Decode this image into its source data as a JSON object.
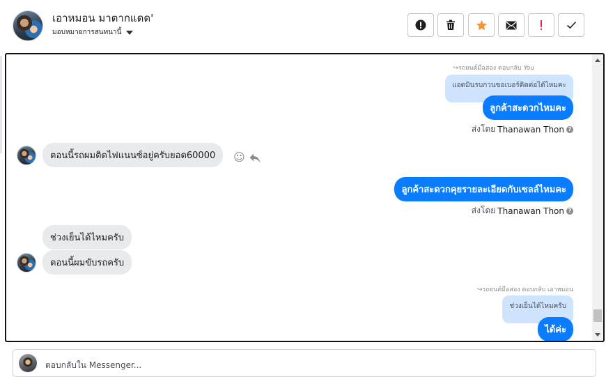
{
  "contact": {
    "name": "เอาหมอน มาตากแดด'",
    "assign_label": "มอบหมายการสนทนานี้"
  },
  "toolbar": {
    "buttons": [
      {
        "name": "spam-button",
        "icon": "alert-circle-icon",
        "glyph": "!",
        "color": "#1c1e21"
      },
      {
        "name": "delete-button",
        "icon": "trash-icon",
        "glyph": "🗑",
        "color": "#1c1e21"
      },
      {
        "name": "star-button",
        "icon": "star-icon",
        "glyph": "★",
        "color": "#f7923a"
      },
      {
        "name": "mark-unread-button",
        "icon": "envelope-icon",
        "glyph": "✉",
        "color": "#1c1e21"
      },
      {
        "name": "follow-up-button",
        "icon": "exclamation-icon",
        "glyph": "!",
        "color": "#e41e3f"
      },
      {
        "name": "done-button",
        "icon": "check-icon",
        "glyph": "✓",
        "color": "#1c1e21"
      }
    ]
  },
  "messages": {
    "reply1_note": "รถยนต์มือสอง ตอบกลับ You",
    "reply1_quote": "แอดมินรบกวนขอเบอร์ติดต่อได้ไหมคะ",
    "out1": "ลูกค้าสะดวกไหมคะ",
    "sent_by_prefix": "ส่งโดย",
    "sent_by_name": "Thanawan Thon",
    "in1": "ตอนนี้รถผมติดไฟแนนซ์อยู่ครับยอด60000",
    "out2": "ลูกค้าสะดวกคุยรายละเอียดกับเซลล์ไหมคะ",
    "in2": "ช่วงเย็นได้ไหมครับ",
    "in3": "ตอนนี้ผมขับรถครับ",
    "reply2_note": "รถยนต์มือสอง ตอบกลับ เอาหมอน",
    "reply2_quote": "ช่วงเย็นได้ไหมครับ",
    "out3": "ได้ค่ะ"
  },
  "composer": {
    "placeholder": "ตอบกลับใน Messenger..."
  },
  "colors": {
    "outgoing": "#0a7cff",
    "incoming": "#e9eaeb",
    "quote": "#cfe4ff"
  }
}
